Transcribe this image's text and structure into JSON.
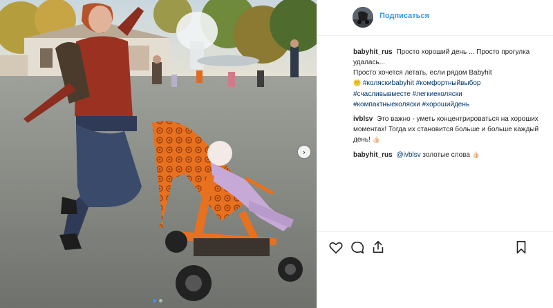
{
  "header": {
    "follow_label": "Подписаться",
    "avatar_icon": "stroller-avatar-icon"
  },
  "comments": [
    {
      "user": "babyhit_rus",
      "text_1": "Просто хороший день ... Просто прогулка удалась...",
      "text_2": "Просто хочется летать, если рядом Babyhit",
      "emoji_1": "🙂",
      "tags": [
        "#коляскиbabyhit",
        "#комфортныйвыбор",
        "#счасливывместе",
        "#легкиеколяски",
        "#компактныеколяски",
        "#хорошийдень"
      ]
    },
    {
      "user": "ivblsv",
      "text": "Это важно - уметь концентрироваться на хороших моментах! Тогда их становится больше и больше каждый день!",
      "emoji": "👍🏻"
    },
    {
      "user": "babyhit_rus",
      "mention": "@ivblsv",
      "text": "золотые слова",
      "emoji": "👍🏻"
    }
  ],
  "actions": {
    "like_icon": "heart-icon",
    "comment_icon": "comment-icon",
    "share_icon": "share-icon",
    "save_icon": "bookmark-icon"
  },
  "carousel": {
    "next_glyph": "›",
    "slides_total": 2,
    "current_slide": 1
  },
  "colors": {
    "accent": "#3897f0",
    "hashtag": "#003569",
    "stroller_orange": "#e8711f"
  }
}
